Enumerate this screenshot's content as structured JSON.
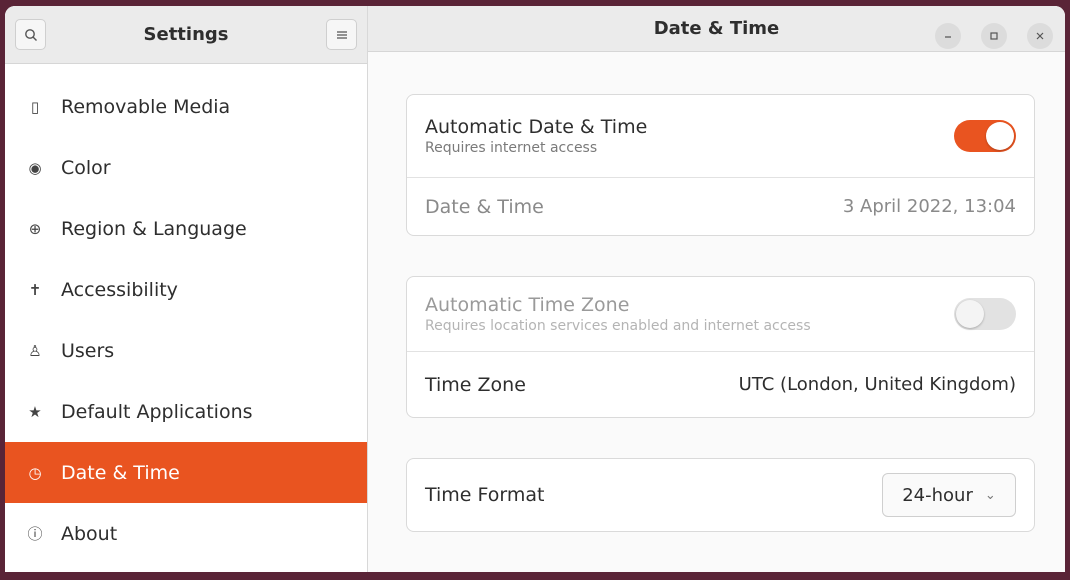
{
  "sidebar": {
    "title": "Settings",
    "search_icon": "search-icon",
    "menu_icon": "hamburger-menu-icon",
    "items": [
      {
        "label": "Removable Media",
        "icon": "▯",
        "name": "removable-media"
      },
      {
        "label": "Color",
        "icon": "◉",
        "name": "color"
      },
      {
        "label": "Region & Language",
        "icon": "⊕",
        "name": "region-language"
      },
      {
        "label": "Accessibility",
        "icon": "✝",
        "name": "accessibility"
      },
      {
        "label": "Users",
        "icon": "♙",
        "name": "users"
      },
      {
        "label": "Default Applications",
        "icon": "★",
        "name": "default-applications"
      },
      {
        "label": "Date & Time",
        "icon": "◷",
        "name": "date-time",
        "active": true
      },
      {
        "label": "About",
        "icon": "ⓘ",
        "name": "about"
      }
    ]
  },
  "header": {
    "title": "Date & Time",
    "controls": [
      "minimize",
      "maximize",
      "close"
    ]
  },
  "groups": {
    "auto_datetime": {
      "label": "Automatic Date & Time",
      "sub": "Requires internet access",
      "enabled": true
    },
    "datetime": {
      "label": "Date & Time",
      "value": "3 April 2022, 13:04"
    },
    "auto_timezone": {
      "label": "Automatic Time Zone",
      "sub": "Requires location services enabled and internet access",
      "enabled": false
    },
    "timezone": {
      "label": "Time Zone",
      "value": "UTC (London, United Kingdom)"
    },
    "time_format": {
      "label": "Time Format",
      "value": "24-hour"
    }
  },
  "colors": {
    "accent": "#e95420"
  }
}
